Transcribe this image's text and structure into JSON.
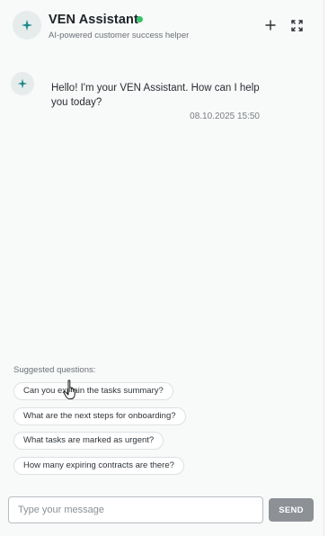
{
  "header": {
    "title": "VEN Assistant",
    "subtitle": "AI-powered customer success helper",
    "status": "online",
    "status_color": "#34c46a",
    "icons": {
      "avatar": "sparkle-icon",
      "new_chat": "plus-icon",
      "expand": "expand-icon"
    }
  },
  "messages": [
    {
      "sender": "assistant",
      "avatar_icon": "sparkle-icon",
      "text": "Hello! I'm your VEN Assistant. How can I help you today?",
      "timestamp": "08.10.2025 15:50"
    }
  ],
  "suggestions": {
    "label": "Suggested questions:",
    "items": [
      "Can you explain the tasks summary?",
      "What are the next steps for onboarding?",
      "What tasks are marked as urgent?",
      "How many expiring contracts are there?"
    ]
  },
  "composer": {
    "placeholder": "Type your message",
    "value": "",
    "send_label": "SEND"
  },
  "colors": {
    "accent": "#1f8a8a",
    "send_button": "#8d9196"
  }
}
